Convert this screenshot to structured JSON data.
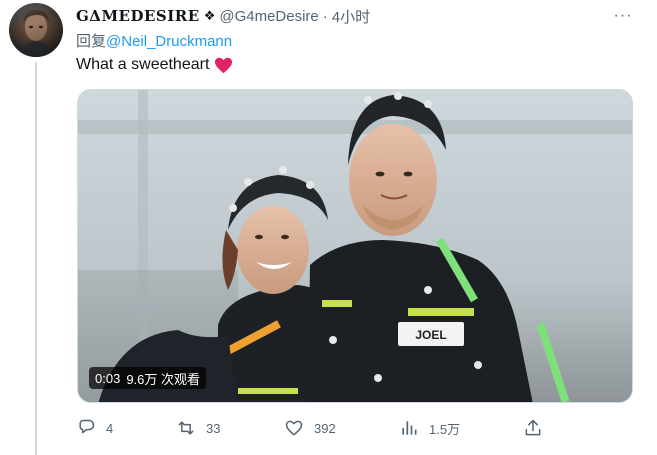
{
  "tweet": {
    "display_name": "GΔMEDESIRE",
    "name_badge": "❖",
    "handle": "@G4meDesire",
    "separator": "·",
    "time": "4小时",
    "more_label": "···",
    "reply_prefix": "回复",
    "reply_mention": "@Neil_Druckmann",
    "text": "What a sweetheart",
    "heart_color": "#e0245e",
    "accent_color": "#1d9bf0"
  },
  "video": {
    "duration": "0:03",
    "views": "9.6万 次观看",
    "badge_name": "JOEL"
  },
  "actions": {
    "replies": "4",
    "retweets": "33",
    "likes": "392",
    "views": "1.5万",
    "reply_icon": "reply-icon",
    "retweet_icon": "retweet-icon",
    "like_icon": "heart-icon",
    "views_icon": "analytics-icon",
    "share_icon": "share-icon"
  }
}
